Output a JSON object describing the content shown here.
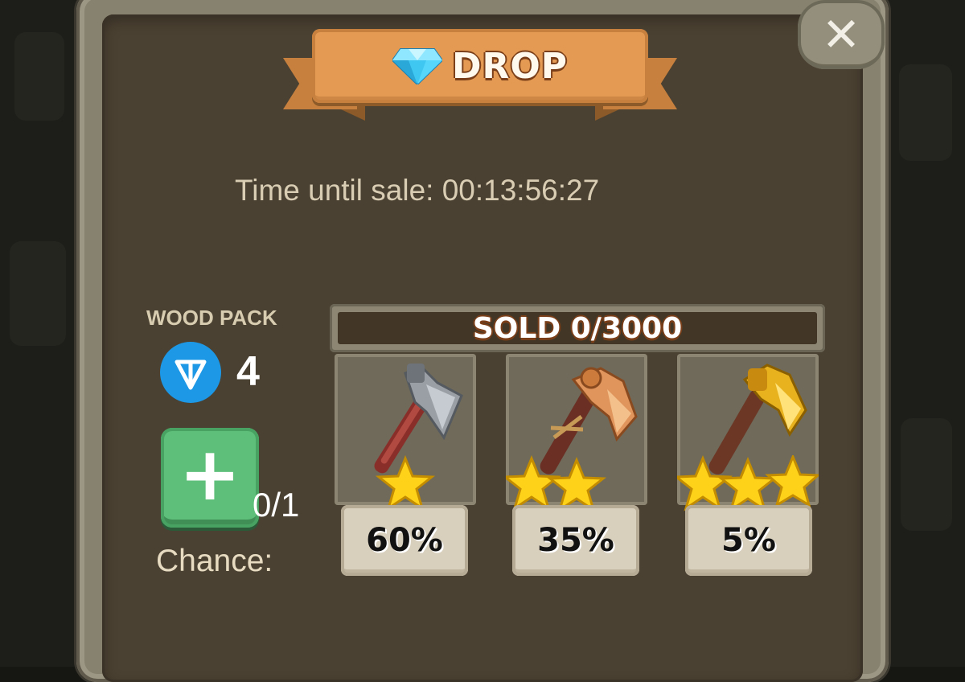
{
  "header": {
    "title": "DROP",
    "title_icon": "diamond-gem-icon",
    "close_icon": "close-x-icon"
  },
  "timer": {
    "text": "Time until sale: 00:13:56:27"
  },
  "pack": {
    "label": "WOOD PACK",
    "currency_icon": "ton-coin-icon",
    "price": "4",
    "add_icon": "plus-icon",
    "count": "0/1",
    "chance_label": "Chance:"
  },
  "sold": {
    "text": "SOLD 0/3000"
  },
  "items": [
    {
      "name": "iron-axe",
      "stars": 1,
      "chance": "60%"
    },
    {
      "name": "copper-axe",
      "stars": 2,
      "chance": "35%"
    },
    {
      "name": "golden-axe",
      "stars": 3,
      "chance": "5%"
    }
  ],
  "colors": {
    "accent": "#e49a52",
    "panel": "#4b4132",
    "add_button": "#5dbf79",
    "ton_blue": "#1d98e6"
  }
}
